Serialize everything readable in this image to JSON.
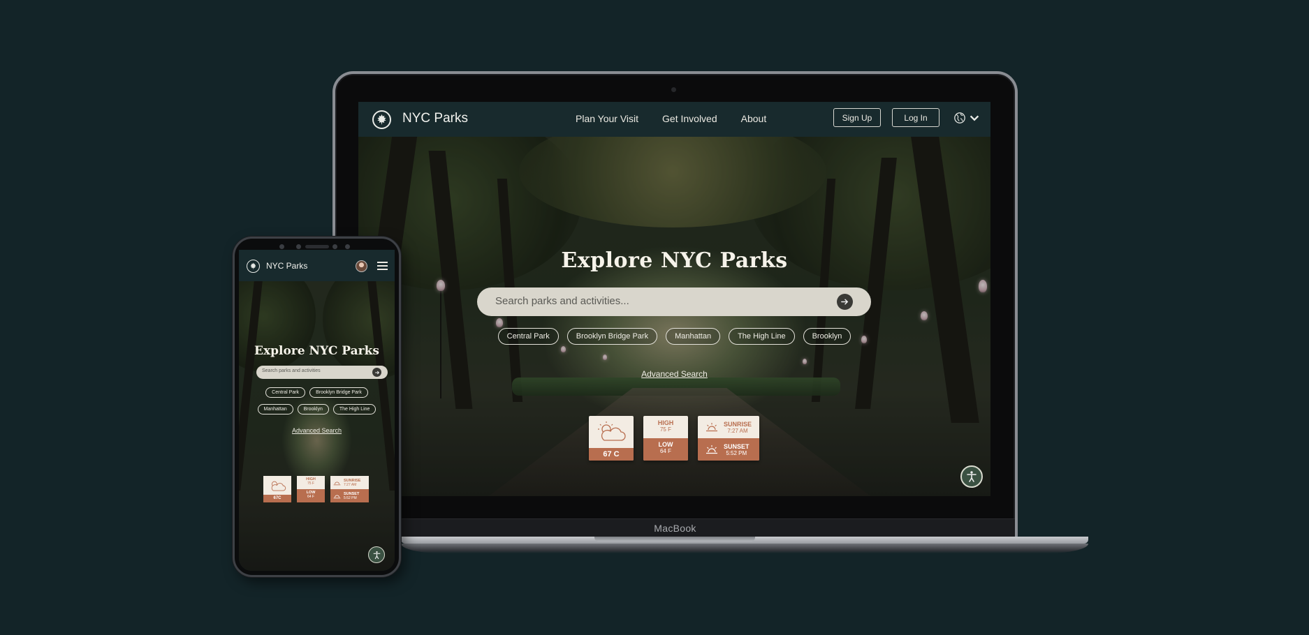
{
  "colors": {
    "background": "#132428",
    "nav": "#182a2d",
    "accent": "#b86e4f",
    "card": "#f3ece3"
  },
  "laptop": {
    "device_label": "MacBook",
    "nav": {
      "brand": "NYC Parks",
      "links": [
        "Plan Your Visit",
        "Get Involved",
        "About"
      ],
      "signup": "Sign Up",
      "login": "Log In",
      "language_icon": "globe-icon"
    },
    "hero": {
      "title": "Explore NYC Parks",
      "search_placeholder": "Search parks and activities...",
      "chips": [
        "Central Park",
        "Brooklyn Bridge Park",
        "Manhattan",
        "The High Line",
        "Brooklyn"
      ],
      "advanced_search": "Advanced Search"
    },
    "weather": {
      "current": "67 C",
      "high_label": "HIGH",
      "high": "75 F",
      "low_label": "LOW",
      "low": "64 F",
      "sunrise_label": "SUNRISE",
      "sunrise": "7:27 AM",
      "sunset_label": "SUNSET",
      "sunset": "5:52 PM"
    }
  },
  "phone": {
    "nav": {
      "brand": "NYC Parks"
    },
    "hero": {
      "title": "Explore NYC Parks",
      "search_placeholder": "Search parks and activities",
      "chips_row1": [
        "Central Park",
        "Brooklyn Bridge Park"
      ],
      "chips_row2": [
        "Manhattan",
        "Brooklyn",
        "The High Line"
      ],
      "advanced_search": "Advanced Search"
    },
    "weather": {
      "current": "67C",
      "high_label": "HIGH",
      "high": "75 F",
      "low_label": "LOW",
      "low": "64 F",
      "sunrise_label": "SUNRISE",
      "sunrise": "7:27 AM",
      "sunset_label": "SUNSET",
      "sunset": "5:52 PM"
    }
  }
}
